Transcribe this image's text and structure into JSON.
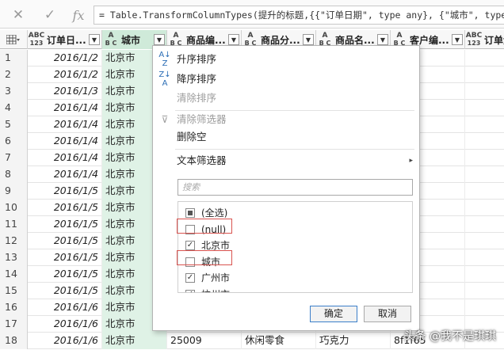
{
  "formula_bar": {
    "cancel_icon": "✕",
    "confirm_icon": "✓",
    "fx_label": "fx",
    "formula": "= Table.TransformColumnTypes(提升的标题,{{\"订单日期\", type any}, {\"城市\", type"
  },
  "columns": [
    {
      "type_top": "ABC",
      "type_bottom": "123",
      "label": "订单日..."
    },
    {
      "type_top": "A",
      "type_bottom": "B C",
      "label": "城市"
    },
    {
      "type_top": "A",
      "type_bottom": "B C",
      "label": "商品编..."
    },
    {
      "type_top": "A",
      "type_bottom": "B C",
      "label": "商品分..."
    },
    {
      "type_top": "A",
      "type_bottom": "B C",
      "label": "商品名..."
    },
    {
      "type_top": "A",
      "type_bottom": "B C",
      "label": "客户编..."
    },
    {
      "type_top": "ABC",
      "type_bottom": "123",
      "label": "订单金"
    }
  ],
  "rows": [
    {
      "idx": "1",
      "date": "2016/1/2",
      "city": "北京市"
    },
    {
      "idx": "2",
      "date": "2016/1/2",
      "city": "北京市"
    },
    {
      "idx": "3",
      "date": "2016/1/3",
      "city": "北京市"
    },
    {
      "idx": "4",
      "date": "2016/1/4",
      "city": "北京市"
    },
    {
      "idx": "5",
      "date": "2016/1/4",
      "city": "北京市"
    },
    {
      "idx": "6",
      "date": "2016/1/4",
      "city": "北京市"
    },
    {
      "idx": "7",
      "date": "2016/1/4",
      "city": "北京市"
    },
    {
      "idx": "8",
      "date": "2016/1/4",
      "city": "北京市"
    },
    {
      "idx": "9",
      "date": "2016/1/5",
      "city": "北京市"
    },
    {
      "idx": "10",
      "date": "2016/1/5",
      "city": "北京市"
    },
    {
      "idx": "11",
      "date": "2016/1/5",
      "city": "北京市"
    },
    {
      "idx": "12",
      "date": "2016/1/5",
      "city": "北京市"
    },
    {
      "idx": "13",
      "date": "2016/1/5",
      "city": "北京市"
    },
    {
      "idx": "14",
      "date": "2016/1/5",
      "city": "北京市"
    },
    {
      "idx": "15",
      "date": "2016/1/5",
      "city": "北京市"
    },
    {
      "idx": "16",
      "date": "2016/1/6",
      "city": "北京市"
    },
    {
      "idx": "17",
      "date": "2016/1/6",
      "city": "北京市"
    },
    {
      "idx": "18",
      "date": "2016/1/6",
      "city": "北京市",
      "id": "25009",
      "cat": "休闲零食",
      "name": "巧克力",
      "cust": "8f1f65"
    }
  ],
  "menu": {
    "sort_asc": "升序排序",
    "sort_desc": "降序排序",
    "clear_sort": "清除排序",
    "clear_filter": "清除筛选器",
    "remove_empty": "删除空",
    "text_filters": "文本筛选器",
    "search_placeholder": "搜索",
    "options": [
      {
        "label": "(全选)",
        "state": "partial"
      },
      {
        "label": "(null)",
        "state": "unchecked"
      },
      {
        "label": "北京市",
        "state": "checked"
      },
      {
        "label": "城市",
        "state": "unchecked"
      },
      {
        "label": "广州市",
        "state": "checked"
      },
      {
        "label": "杭州市",
        "state": "checked"
      }
    ],
    "ok_label": "确定",
    "cancel_label": "取消"
  },
  "watermark": "头条 @我不是琪琪",
  "colors": {
    "selected_column": "#cfead9",
    "highlight_box": "#d9534f",
    "ok_border": "#3c7fc9"
  }
}
